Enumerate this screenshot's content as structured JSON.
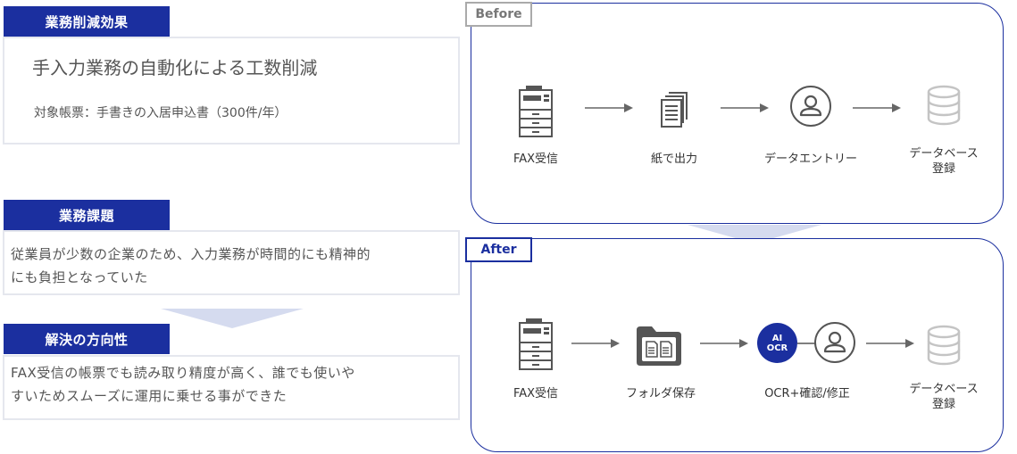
{
  "left": {
    "effect_header": "業務削減効果",
    "effect_title": "手入力業務の自動化による工数削減",
    "effect_sub": "対象帳票：手書きの入居申込書（300件/年）",
    "issue_header": "業務課題",
    "issue_text_1": "従業員が少数の企業のため、入力業務が時間的にも精神的",
    "issue_text_2": "にも負担となっていた",
    "solution_header": "解決の方向性",
    "solution_text_1": "FAX受信の帳票でも読み取り精度が高く、誰でも使いや",
    "solution_text_2": "すいためスムーズに運用に乗せる事ができた"
  },
  "before": {
    "tag": "Before",
    "steps": [
      {
        "label": "FAX受信",
        "icon": "fax-machine-icon"
      },
      {
        "label": "紙で出力",
        "icon": "paper-stack-icon"
      },
      {
        "label": "データエントリー",
        "icon": "person-icon"
      },
      {
        "label": "データベース\n登録",
        "icon": "database-icon"
      }
    ]
  },
  "after": {
    "tag": "After",
    "ai_badge": "AI",
    "ocr_badge": "OCR",
    "steps": [
      {
        "label": "FAX受信",
        "icon": "fax-machine-icon"
      },
      {
        "label": "フォルダ保存",
        "icon": "folder-icon"
      },
      {
        "label": "OCR+確認/修正",
        "icon": "ai-ocr-person-icon"
      },
      {
        "label": "データベース\n登録",
        "icon": "database-icon"
      }
    ]
  },
  "colors": {
    "brand_navy": "#1b2f9f",
    "chevron": "#d5dbef",
    "icon_gray": "#555555",
    "db_gray": "#c4c4c4"
  }
}
